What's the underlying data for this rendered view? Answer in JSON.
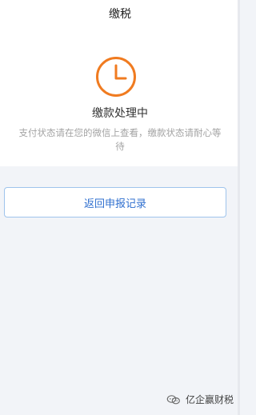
{
  "header": {
    "title": "缴税"
  },
  "status": {
    "icon": "clock-icon",
    "title": "缴款处理中",
    "description": "支付状态请在您的微信上查看，缴款状态请耐心等待"
  },
  "actions": {
    "return_button_label": "返回申报记录"
  },
  "watermark": {
    "icon": "wechat-icon",
    "text": "亿企赢财税"
  },
  "colors": {
    "accent": "#f07b20",
    "link": "#2f6fcf",
    "background": "#f2f4f8"
  }
}
